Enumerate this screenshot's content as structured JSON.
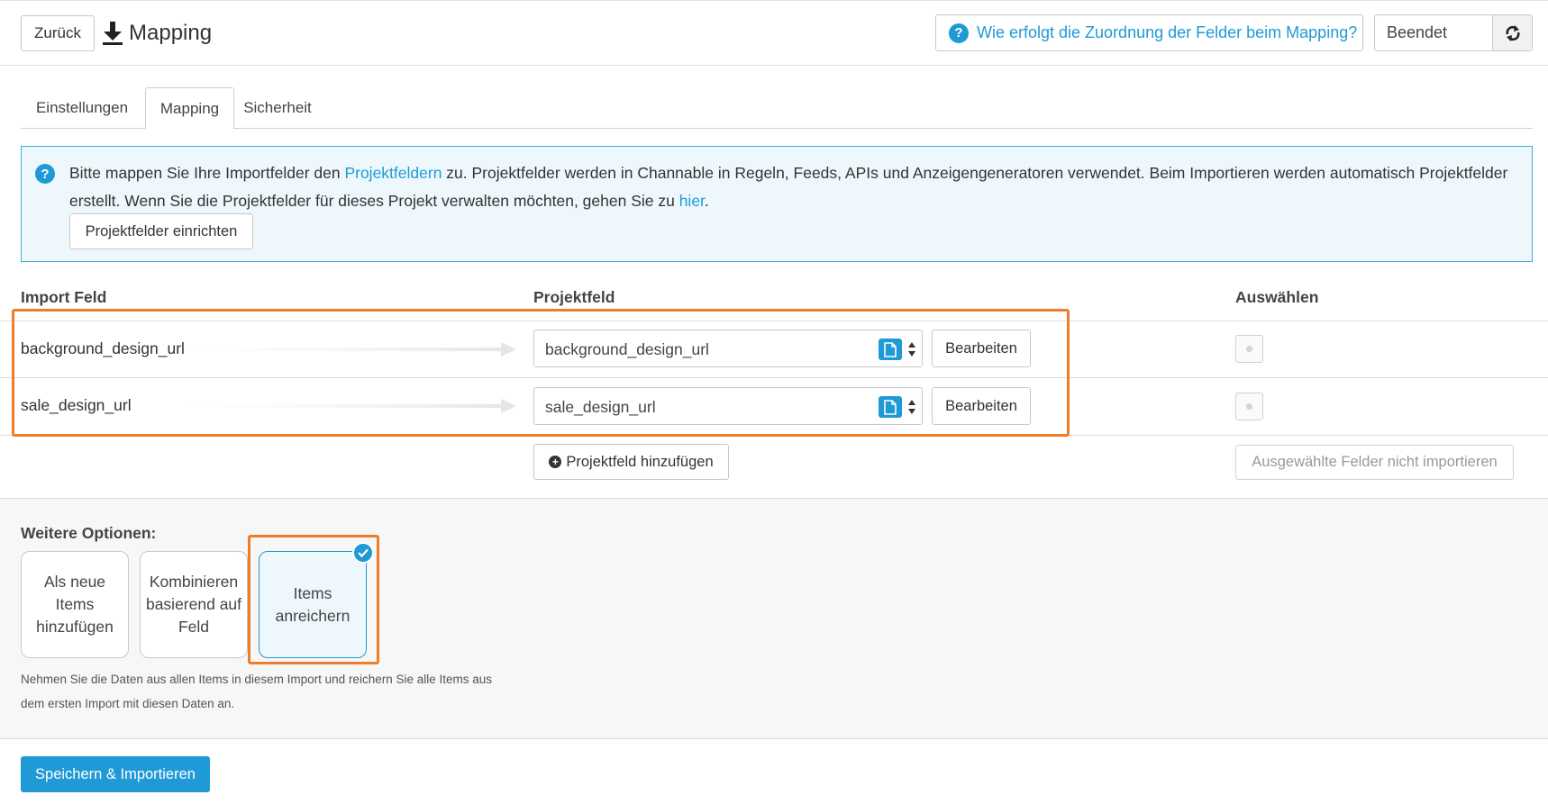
{
  "header": {
    "back_label": "Zurück",
    "title": "Mapping",
    "title_icon": "download-icon",
    "help_label": "Wie erfolgt die Zuordnung der Felder beim Mapping?",
    "status_label": "Beendet",
    "refresh_icon": "refresh-icon"
  },
  "tabs": [
    {
      "label": "Einstellungen",
      "active": false
    },
    {
      "label": "Mapping",
      "active": true
    },
    {
      "label": "Sicherheit",
      "active": false
    }
  ],
  "info": {
    "text_1": "Bitte mappen Sie Ihre Importfelder den ",
    "link_1": "Projektfeldern",
    "text_2": " zu. Projektfelder werden in Channable in Regeln, Feeds, APIs und Anzeigengeneratoren verwendet. Beim Importieren werden automatisch Projektfelder erstellt. Wenn Sie die Projektfelder für dieses Projekt verwalten möchten, gehen Sie zu ",
    "link_2": "hier",
    "text_3": ".",
    "button_label": "Projektfelder einrichten"
  },
  "table": {
    "columns": [
      "Import Feld",
      "Projektfeld",
      "Auswählen"
    ],
    "rows": [
      {
        "import_field": "background_design_url",
        "project_field": "background_design_url",
        "edit_label": "Bearbeiten"
      },
      {
        "import_field": "sale_design_url",
        "project_field": "sale_design_url",
        "edit_label": "Bearbeiten"
      }
    ],
    "add_label": "Projektfeld hinzufügen",
    "skip_label": "Ausgewählte Felder nicht importieren"
  },
  "options": {
    "title": "Weitere Optionen:",
    "cards": [
      {
        "label": "Als neue Items hinzufügen",
        "selected": false
      },
      {
        "label": "Kombinieren basierend auf Feld",
        "selected": false
      },
      {
        "label": "Items anreichern",
        "selected": true
      }
    ],
    "description": "Nehmen Sie die Daten aus allen Items in diesem Import und reichern Sie alle Items aus dem ersten Import mit diesen Daten an."
  },
  "footer": {
    "save_label": "Speichern & Importieren"
  },
  "colors": {
    "accent": "#1f9ad6",
    "highlight": "#ee7d2a",
    "info_bg": "#eef8fc"
  }
}
